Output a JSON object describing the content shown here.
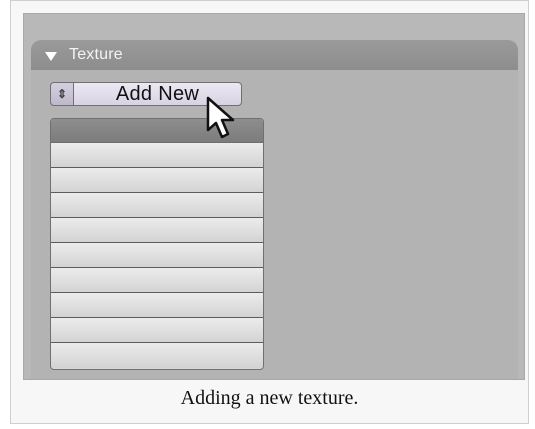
{
  "panel": {
    "title": "Texture",
    "selector_symbol": "⇕",
    "add_new_label": "Add New"
  },
  "caption": "Adding a new texture.",
  "list": {
    "rows": 9
  }
}
